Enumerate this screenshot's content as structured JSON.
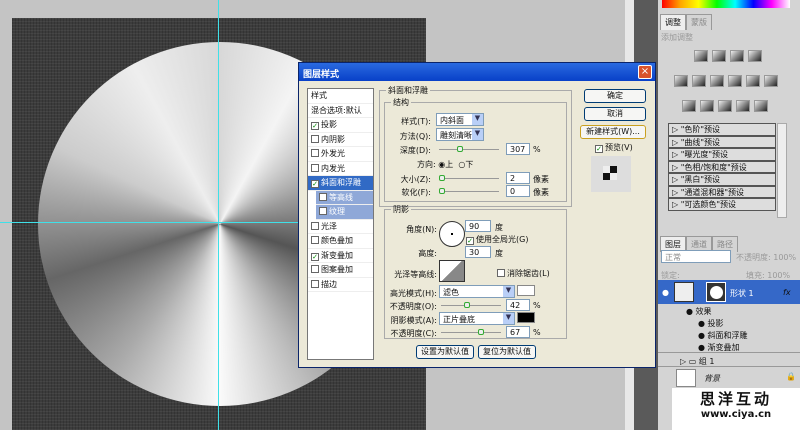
{
  "dialog": {
    "title": "图层样式",
    "close": "×",
    "styles_list": [
      {
        "label": "样式",
        "checkbox": false,
        "checked": false
      },
      {
        "label": "混合选项:默认",
        "checkbox": false,
        "checked": false
      },
      {
        "label": "投影",
        "checkbox": true,
        "checked": true
      },
      {
        "label": "内阴影",
        "checkbox": true,
        "checked": false
      },
      {
        "label": "外发光",
        "checkbox": true,
        "checked": false
      },
      {
        "label": "内发光",
        "checkbox": true,
        "checked": false
      },
      {
        "label": "斜面和浮雕",
        "checkbox": true,
        "checked": true,
        "selected": true
      },
      {
        "label": "等高线",
        "checkbox": true,
        "checked": false,
        "sub": true
      },
      {
        "label": "纹理",
        "checkbox": true,
        "checked": false,
        "sub": true
      },
      {
        "label": "光泽",
        "checkbox": true,
        "checked": false
      },
      {
        "label": "颜色叠加",
        "checkbox": true,
        "checked": false
      },
      {
        "label": "渐变叠加",
        "checkbox": true,
        "checked": true
      },
      {
        "label": "图案叠加",
        "checkbox": true,
        "checked": false
      },
      {
        "label": "描边",
        "checkbox": true,
        "checked": false
      }
    ],
    "bevel": {
      "group_title": "斜面和浮雕",
      "structure_title": "结构",
      "style_label": "样式(T):",
      "style_value": "内斜面",
      "technique_label": "方法(Q):",
      "technique_value": "雕刻清晰",
      "depth_label": "深度(D):",
      "depth_value": "307",
      "depth_unit": "%",
      "direction_label": "方向:",
      "dir_up": "上",
      "dir_down": "下",
      "direction": "上",
      "size_label": "大小(Z):",
      "size_value": "2",
      "size_unit": "像素",
      "soften_label": "软化(F):",
      "soften_value": "0",
      "soften_unit": "像素"
    },
    "shading": {
      "title": "阴影",
      "angle_label": "角度(N):",
      "angle_value": "90",
      "angle_unit": "度",
      "global_light_label": "使用全局光(G)",
      "global_light": true,
      "altitude_label": "高度:",
      "altitude_value": "30",
      "altitude_unit": "度",
      "gloss_label": "光泽等高线:",
      "antialias_label": "消除锯齿(L)",
      "antialias": false,
      "highlight_label": "高光模式(H):",
      "highlight_value": "滤色",
      "highlight_color": "#ffffff",
      "hl_opacity_label": "不透明度(O):",
      "hl_opacity": "42",
      "pct": "%",
      "shadow_label": "阴影模式(A):",
      "shadow_value": "正片叠底",
      "shadow_color": "#000000",
      "sh_opacity_label": "不透明度(C):",
      "sh_opacity": "67"
    },
    "make_default": "设置为默认值",
    "reset_default": "复位为默认值",
    "ok": "确定",
    "cancel": "取消",
    "new_style": "新建样式(W)...",
    "preview_label": "预览(V)",
    "preview": true
  },
  "panel": {
    "tabs": [
      "调整",
      "蒙版"
    ],
    "add_adjust": "添加调整",
    "presets": [
      "\"色阶\"预设",
      "\"曲线\"预设",
      "\"曝光度\"预设",
      "\"色相/饱和度\"预设",
      "\"黑白\"预设",
      "\"通道混和器\"预设",
      "\"可选颜色\"预设"
    ],
    "layers_tabs": [
      "图层",
      "通道",
      "路径"
    ],
    "blend_mode": "正常",
    "opacity_label": "不透明度:",
    "opacity": "100%",
    "lock_label": "锁定:",
    "fill_label": "填充:",
    "fill": "100%",
    "layers": {
      "shape": "形状 1",
      "fx": "fx",
      "effects": "效果",
      "effect_items": [
        "投影",
        "斜面和浮雕",
        "渐变叠加"
      ],
      "group": "组 1",
      "background": "背景"
    }
  },
  "watermark": {
    "name": "思洋互动",
    "url": "www.ciya.cn"
  },
  "accent": "#316ac5"
}
